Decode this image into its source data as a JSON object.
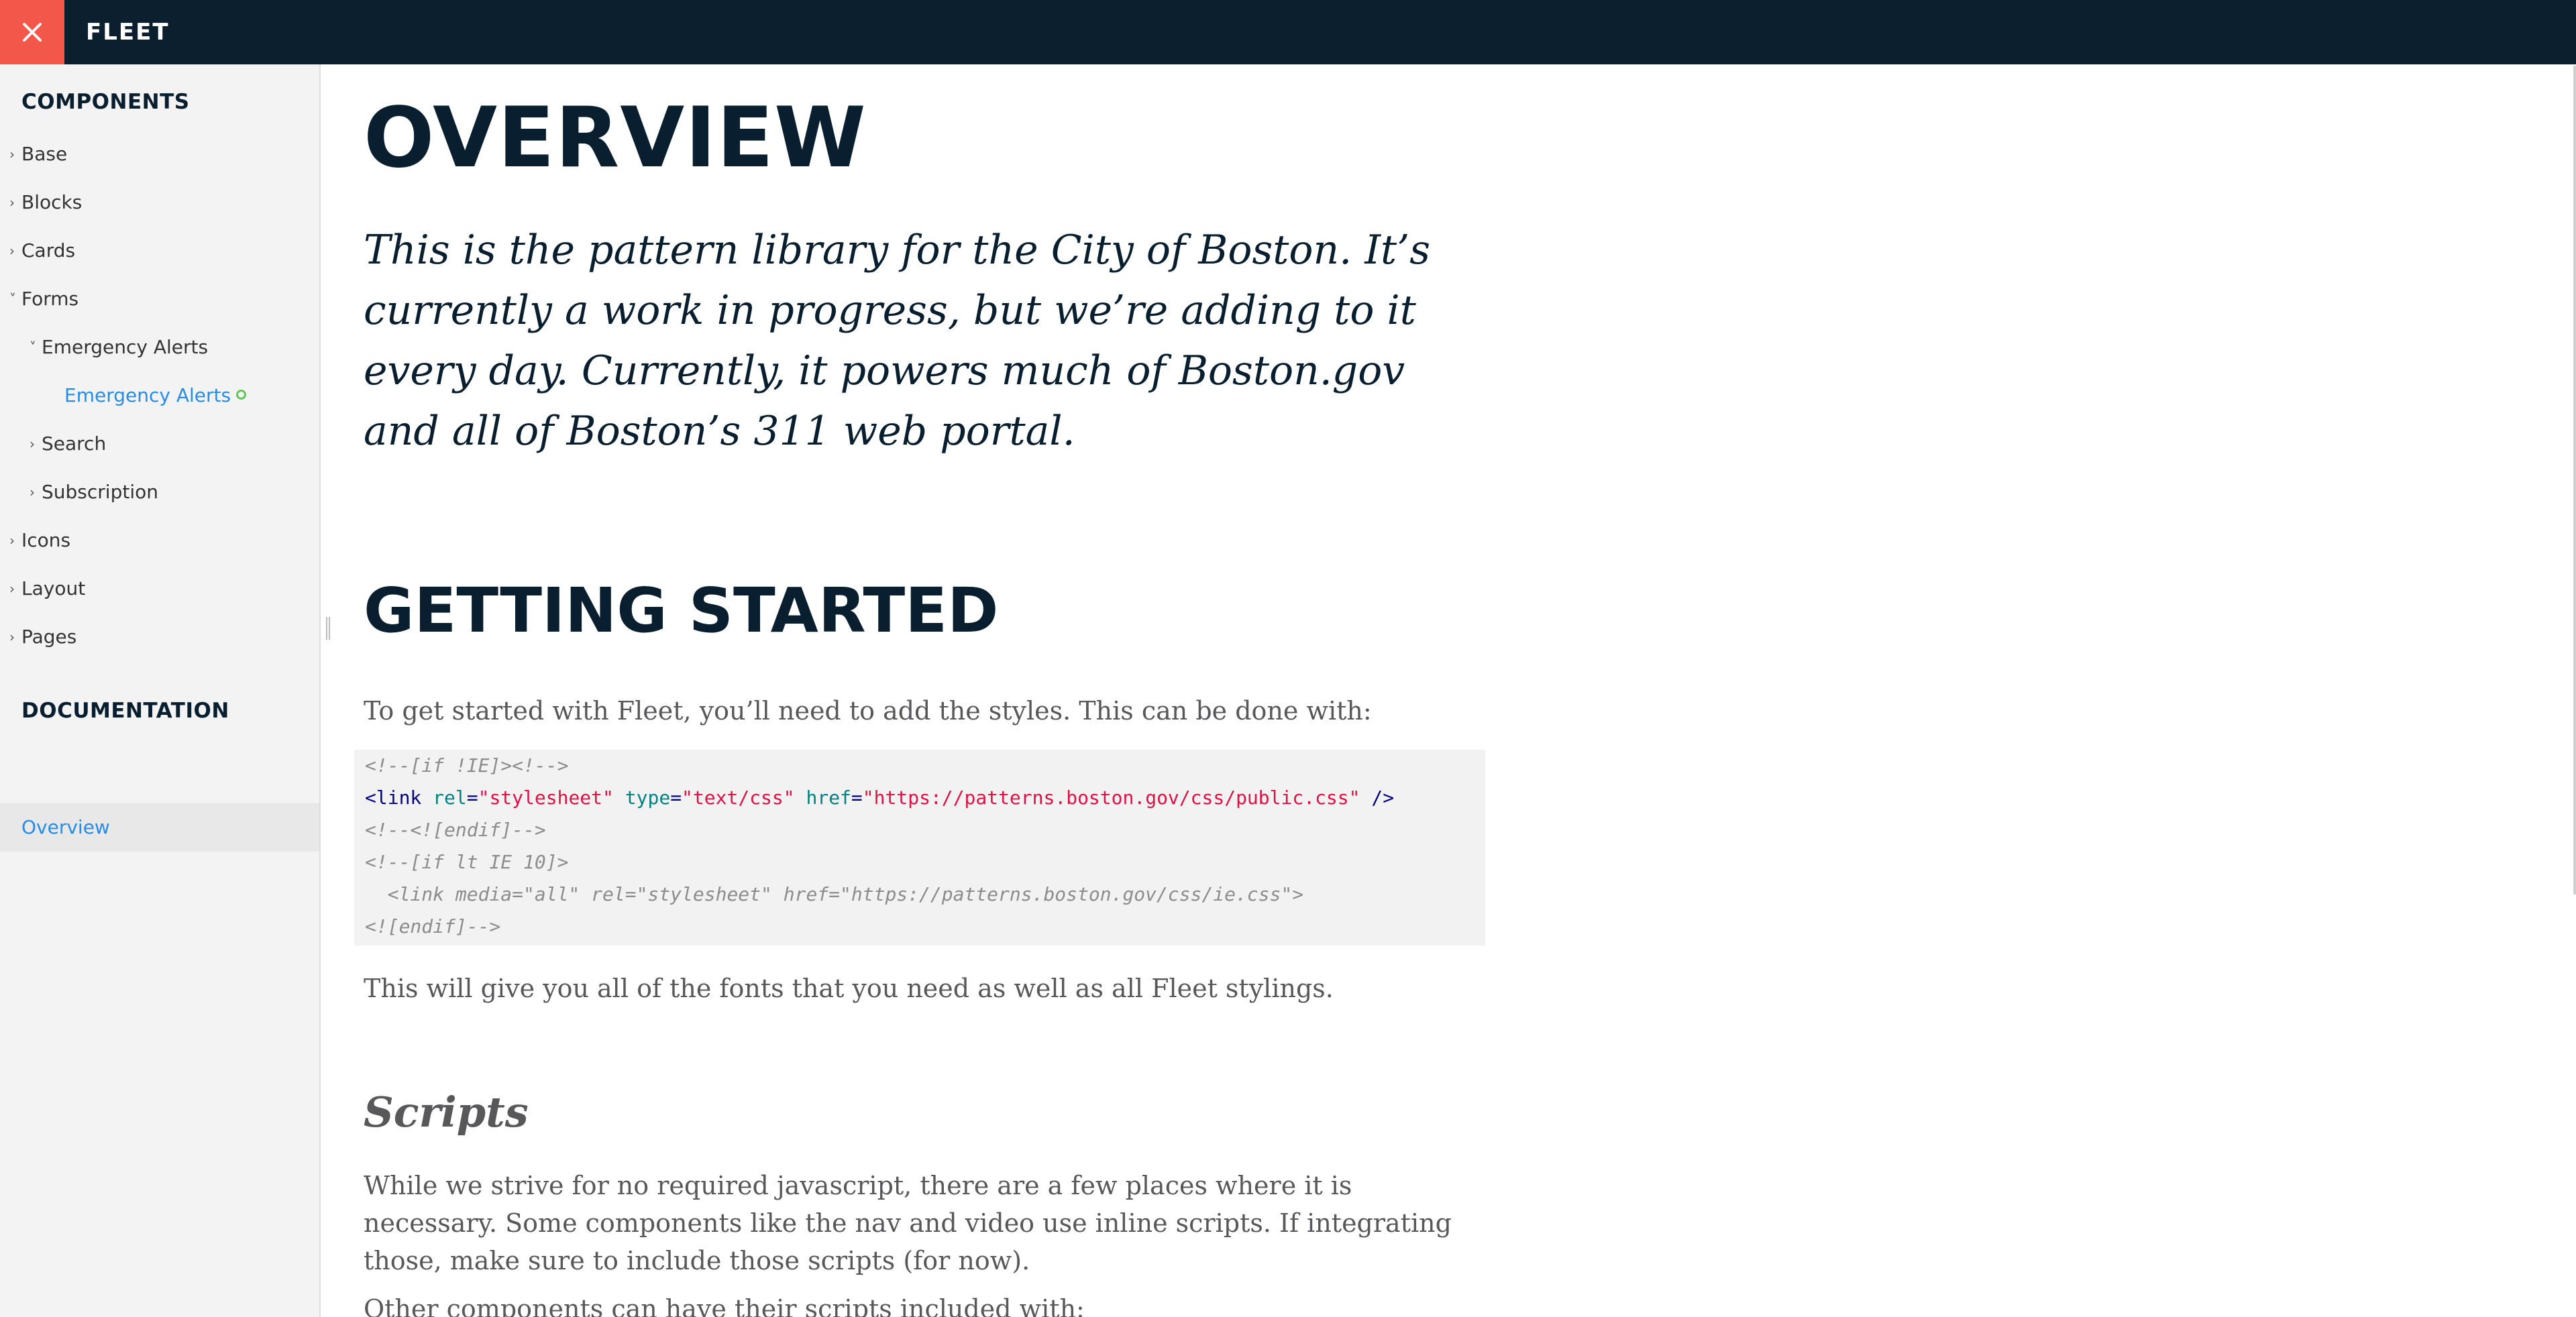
{
  "topbar": {
    "close_icon": "close-icon",
    "brand": "FLEET",
    "colors": {
      "bar": "#0c1f2f",
      "close": "#f2574a"
    }
  },
  "sidebar": {
    "components_heading": "COMPONENTS",
    "items": [
      {
        "label": "Base",
        "level": 0,
        "expanded": false
      },
      {
        "label": "Blocks",
        "level": 0,
        "expanded": false
      },
      {
        "label": "Cards",
        "level": 0,
        "expanded": false
      },
      {
        "label": "Forms",
        "level": 0,
        "expanded": true
      },
      {
        "label": "Emergency Alerts",
        "level": 1,
        "expanded": true
      },
      {
        "label": "Emergency Alerts",
        "level": 2,
        "active": true,
        "status_icon": "status-circle-icon"
      },
      {
        "label": "Search",
        "level": 1,
        "expanded": false
      },
      {
        "label": "Subscription",
        "level": 1,
        "expanded": false
      },
      {
        "label": "Icons",
        "level": 0,
        "expanded": false
      },
      {
        "label": "Layout",
        "level": 0,
        "expanded": false
      },
      {
        "label": "Pages",
        "level": 0,
        "expanded": false
      }
    ],
    "documentation_heading": "DOCUMENTATION",
    "overview_link": "Overview",
    "colors": {
      "link": "#288be4",
      "status_ok": "#62c65d"
    }
  },
  "main": {
    "title": "OVERVIEW",
    "lede": "This is the pattern library for the City of Boston. It’s currently a work in progress, but we’re adding to it every day. Currently, it powers much of Boston.gov and all of Boston’s 311 web portal.",
    "getting_started": "GETTING STARTED",
    "intro": "To get started with Fleet, you’ll need to add the styles. This can be done with:",
    "code": {
      "line1": "<!--[if !IE]><!-->",
      "line2_open": "<link ",
      "line2_attr1": "rel",
      "line2_val1": "\"stylesheet\"",
      "line2_attr2": "type",
      "line2_val2": "\"text/css\"",
      "line2_attr3": "href",
      "line2_val3": "\"https://patterns.boston.gov/css/public.css\"",
      "line2_close": "/>",
      "line3": "<!--<![endif]-->",
      "line4": "<!--[if lt IE 10]>",
      "line5": "  <link media=\"all\" rel=\"stylesheet\" href=\"https://patterns.boston.gov/css/ie.css\">",
      "line6": "<![endif]-->"
    },
    "fonts_note": "This will give you all of the fonts that you need as well as all Fleet stylings.",
    "scripts_heading": "Scripts",
    "scripts_para": "While we strive for no required javascript, there are a few places where it is necessary. Some components like the nav and video use inline scripts. If integrating those, make sure to include those scripts (for now).",
    "scripts_para2": "Other components can have their scripts included with:"
  }
}
